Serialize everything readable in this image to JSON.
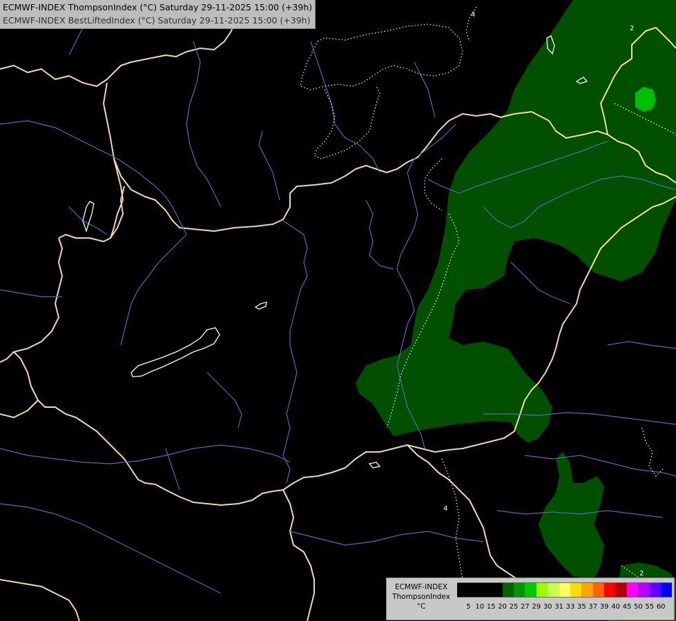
{
  "header": {
    "line1": "ECMWF-INDEX ThompsonIndex (°C) Saturday 29-11-2025 15:00 (+39h)",
    "line2": "ECMWF-INDEX BestLiftedIndex (°C) Saturday 29-11-2025 15:00 (+39h)"
  },
  "legend": {
    "title": "ECMWF-INDEX",
    "subtitle": "ThompsonIndex",
    "unit": "°C",
    "ticks": [
      "5",
      "10",
      "15",
      "20",
      "25",
      "27",
      "29",
      "30",
      "31",
      "33",
      "35",
      "37",
      "39",
      "40",
      "45",
      "50",
      "55",
      "60"
    ],
    "colors": [
      "#000000",
      "#000000",
      "#000000",
      "#000000",
      "#006400",
      "#009600",
      "#00c800",
      "#96ff00",
      "#c8ff50",
      "#ffff64",
      "#ffdc00",
      "#ffa500",
      "#ff6400",
      "#ff0000",
      "#b40000",
      "#ff00ff",
      "#b400ff",
      "#6400ff",
      "#0000ff"
    ]
  },
  "map": {
    "colors": {
      "background": "#000000",
      "border": "#f5d8a8",
      "river": "#4a6fb5",
      "fill_dark_green": "#005000",
      "fill_bright_green": "#00c000",
      "contour": "#ffffff"
    },
    "contour_labels": [
      "2",
      "4",
      "2",
      "4"
    ]
  }
}
